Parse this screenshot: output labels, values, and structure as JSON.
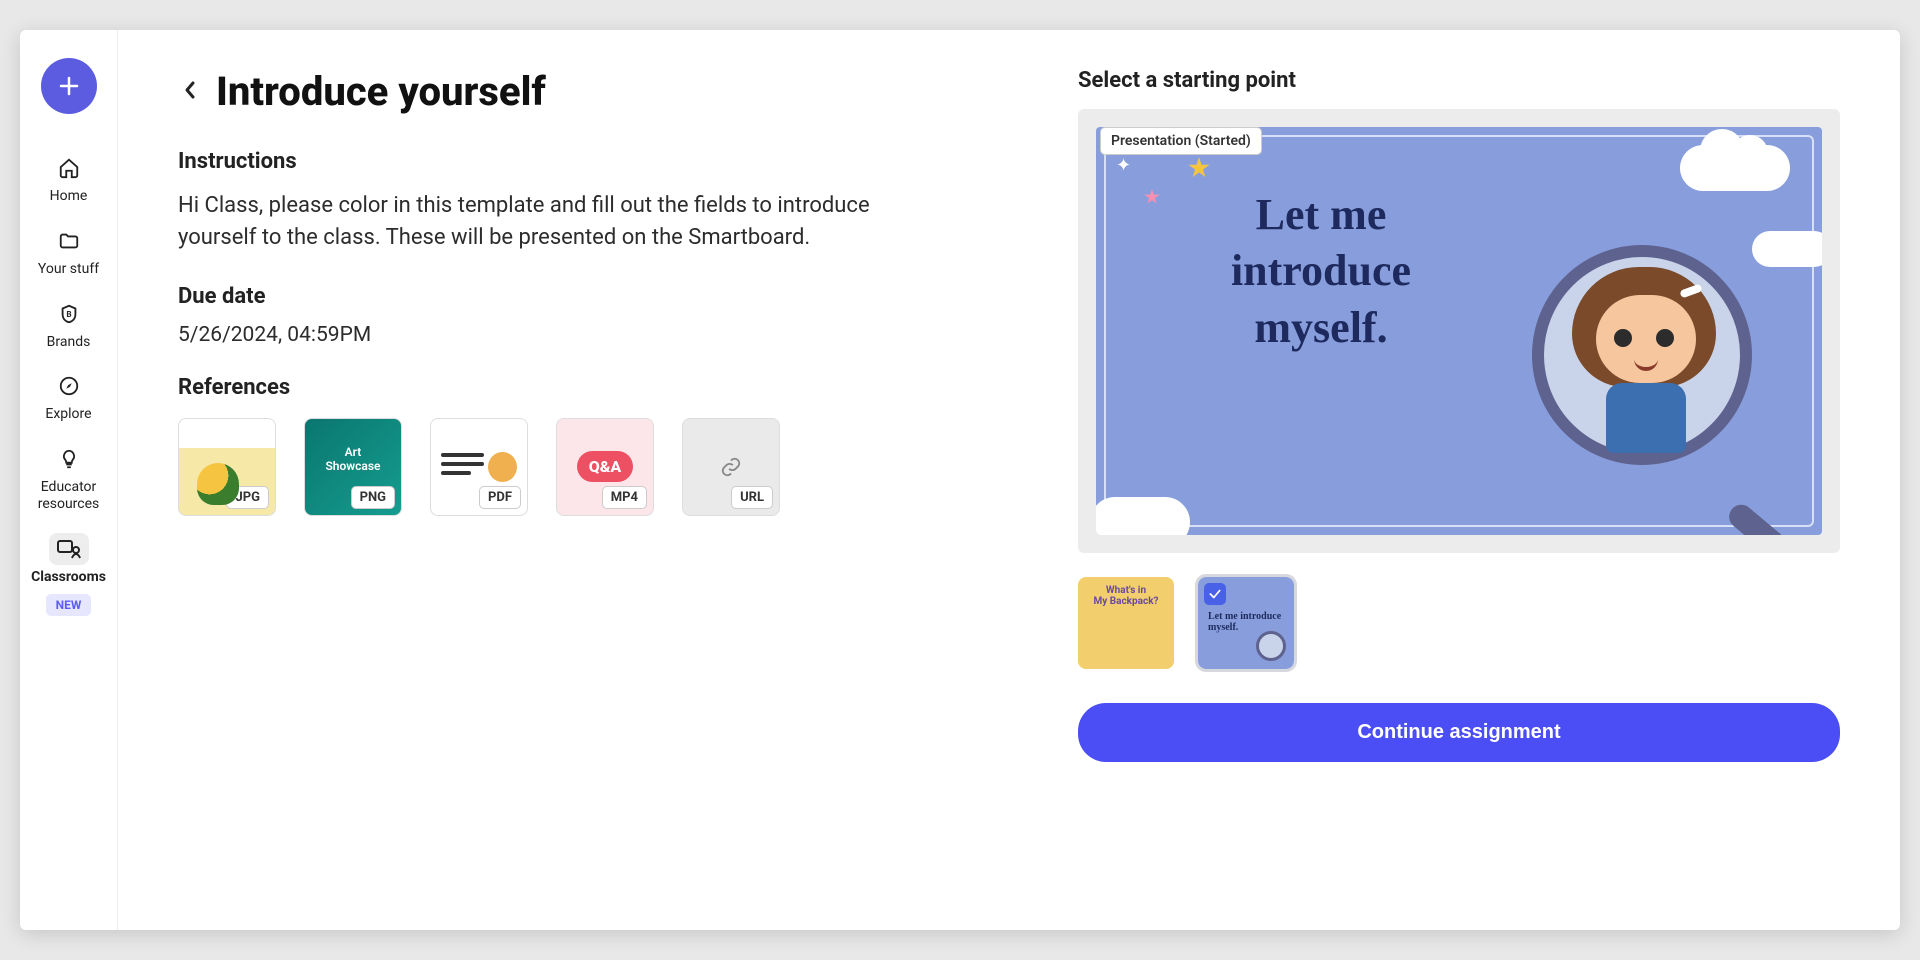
{
  "sidebar": {
    "items": [
      {
        "label": "Home"
      },
      {
        "label": "Your stuff"
      },
      {
        "label": "Brands"
      },
      {
        "label": "Explore"
      },
      {
        "label": "Educator resources"
      },
      {
        "label": "Classrooms"
      }
    ],
    "new_badge": "NEW"
  },
  "page": {
    "title": "Introduce yourself",
    "instructions_heading": "Instructions",
    "instructions_text": "Hi Class, please color in this template and fill out the fields to introduce yourself to the class. These will be presented on the Smartboard.",
    "due_heading": "Due date",
    "due_value": "5/26/2024, 04:59PM",
    "references_heading": "References",
    "references": [
      {
        "type": "JPG"
      },
      {
        "type": "PNG"
      },
      {
        "type": "PDF"
      },
      {
        "type": "MP4"
      },
      {
        "type": "URL"
      }
    ]
  },
  "starting_point": {
    "heading": "Select a starting point",
    "status_chip": "Presentation (Started)",
    "slide_text": "Let me introduce myself.",
    "thumb2_text": "Let me introduce myself.",
    "cta_label": "Continue assignment"
  }
}
